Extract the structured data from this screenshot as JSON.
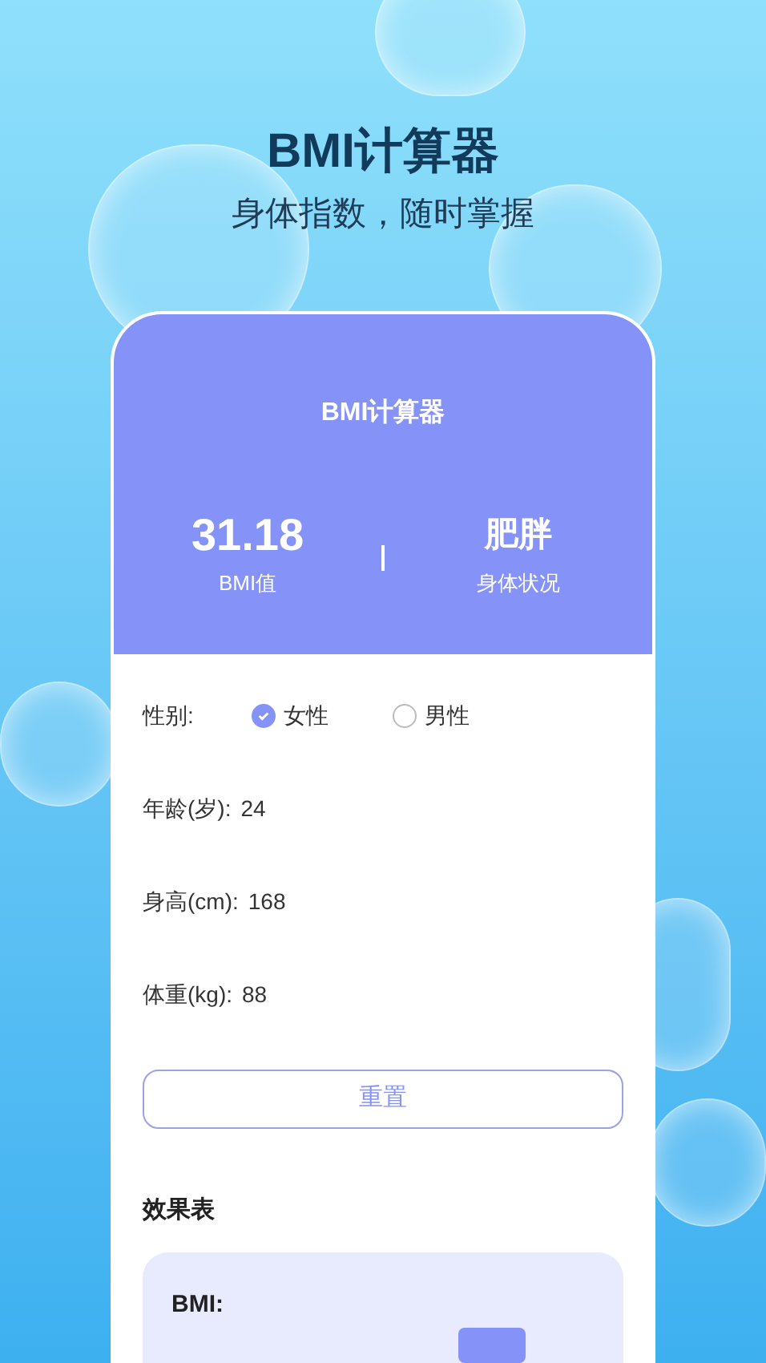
{
  "hero": {
    "title": "BMI计算器",
    "subtitle": "身体指数，随时掌握"
  },
  "card": {
    "title": "BMI计算器",
    "stats": [
      {
        "value": "31.18",
        "label": "BMI值"
      },
      {
        "value": "肥胖",
        "label": "身体状况"
      }
    ]
  },
  "form": {
    "gender_label": "性别:",
    "genders": [
      {
        "label": "女性",
        "selected": true
      },
      {
        "label": "男性",
        "selected": false
      }
    ],
    "fields": [
      {
        "label": "年龄(岁):",
        "value": "24"
      },
      {
        "label": "身高(cm):",
        "value": "168"
      },
      {
        "label": "体重(kg):",
        "value": "88"
      }
    ],
    "reset_button": "重置"
  },
  "results": {
    "title": "效果表",
    "bmi_label": "BMI:"
  }
}
